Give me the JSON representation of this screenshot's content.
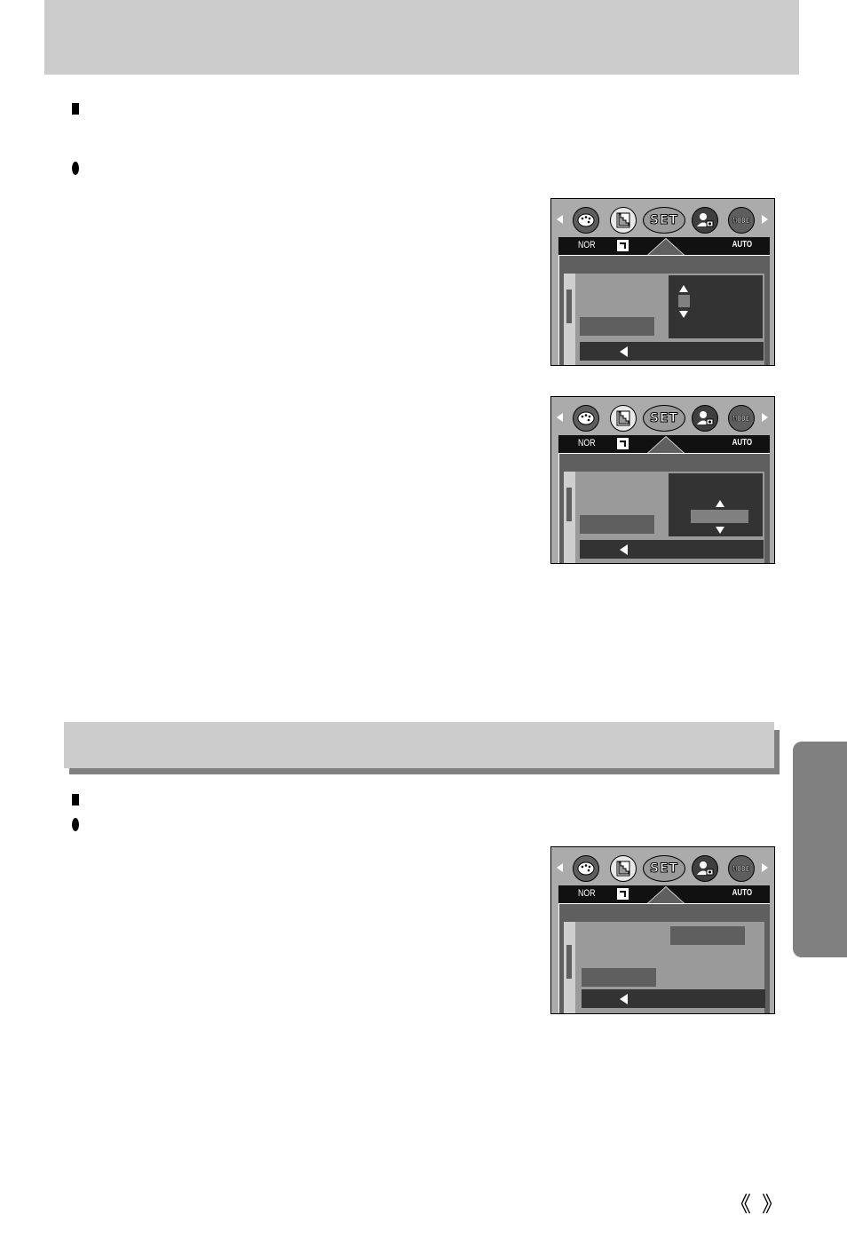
{
  "page": {
    "header_band": "",
    "section_band": "",
    "side_tab": ""
  },
  "bullets": [
    {
      "type": "square",
      "text": ""
    },
    {
      "type": "circle",
      "text": ""
    },
    {
      "type": "square",
      "text": ""
    },
    {
      "type": "circle",
      "text": ""
    }
  ],
  "camera_screens": [
    {
      "icons": [
        "palette-icon",
        "sharpness-icon",
        "set-icon",
        "person-camera-icon",
        "mode-icon"
      ],
      "set_label": "SET",
      "mode_label": "MODE",
      "status_left": "NOR",
      "status_right": "AUTO",
      "variant": "vertical-spinner"
    },
    {
      "icons": [
        "palette-icon",
        "sharpness-icon",
        "set-icon",
        "person-camera-icon",
        "mode-icon"
      ],
      "set_label": "SET",
      "mode_label": "MODE",
      "status_left": "NOR",
      "status_right": "AUTO",
      "variant": "wide-spinner"
    },
    {
      "icons": [
        "palette-icon",
        "sharpness-icon",
        "set-icon",
        "person-camera-icon",
        "mode-icon"
      ],
      "set_label": "SET",
      "mode_label": "MODE",
      "status_left": "NOR",
      "status_right": "AUTO",
      "variant": "option-box"
    }
  ],
  "page_nav": {
    "prev": "《",
    "next": "》"
  }
}
